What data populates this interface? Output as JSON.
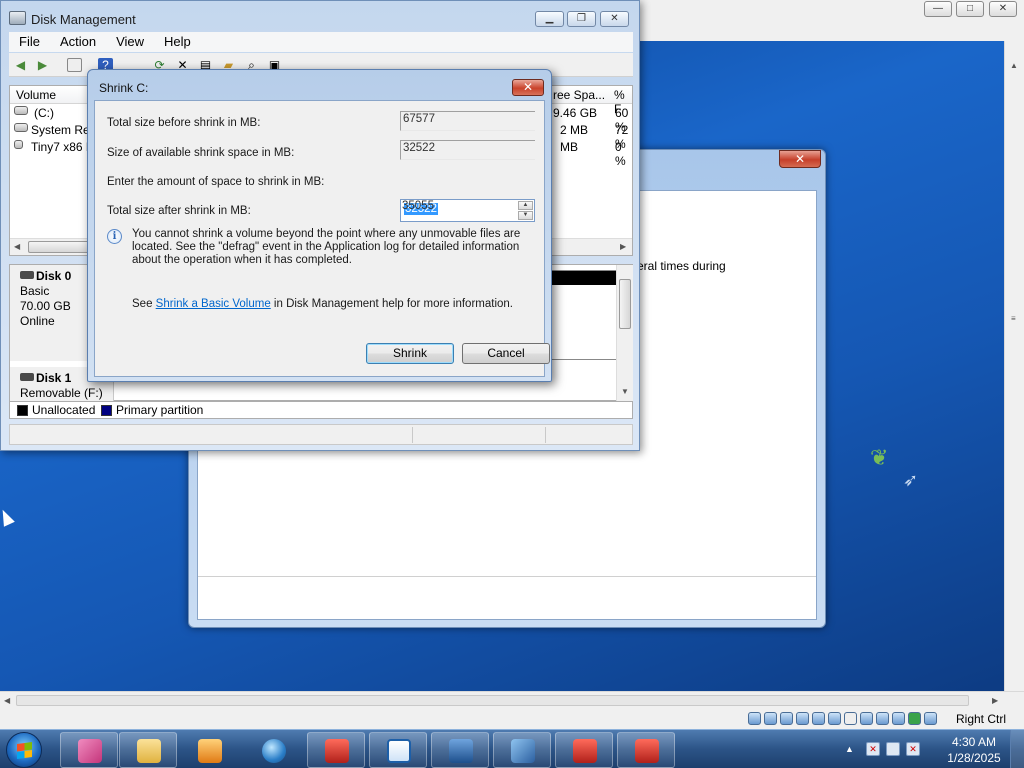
{
  "host": {
    "status_right": "Right Ctrl",
    "window_buttons": [
      "—",
      "□",
      "✕"
    ]
  },
  "background_window": {
    "partial_text": "eral times during"
  },
  "disk_management": {
    "title": "Disk Management",
    "menu": [
      "File",
      "Action",
      "View",
      "Help"
    ],
    "columns": [
      "Volume",
      "ree Spa...",
      "% F"
    ],
    "volumes": [
      {
        "name": "(C:)",
        "free": "9.46 GB",
        "pct": "60 %"
      },
      {
        "name": "System Res",
        "free": "2 MB",
        "pct": "72 %"
      },
      {
        "name": "Tiny7 x86 R",
        "free": "MB",
        "pct": "0 %"
      }
    ],
    "disks": [
      {
        "name": "Disk 0",
        "type": "Basic",
        "size": "70.00 GB",
        "status": "Online"
      },
      {
        "name": "Disk 1",
        "type": "Removable (F:)"
      }
    ],
    "legend": [
      {
        "label": "Unallocated",
        "color": "#000000"
      },
      {
        "label": "Primary partition",
        "color": "#000080"
      }
    ]
  },
  "dialog": {
    "title": "Shrink C:",
    "fields": [
      {
        "label": "Total size before shrink in MB:",
        "value": "67577"
      },
      {
        "label": "Size of available shrink space in MB:",
        "value": "32522"
      },
      {
        "label": "Enter the amount of space to shrink in MB:",
        "value": "32522"
      },
      {
        "label": "Total size after shrink in MB:",
        "value": "35055"
      }
    ],
    "info": "You cannot shrink a volume beyond the point where any unmovable files are located. See the \"defrag\" event in the Application log for detailed information about the operation when it has completed.",
    "help_prefix": "See ",
    "help_link": "Shrink a Basic Volume",
    "help_suffix": " in Disk Management help for more information.",
    "buttons": {
      "shrink": "Shrink",
      "cancel": "Cancel"
    }
  },
  "taskbar": {
    "apps": [
      "ink-app",
      "file-explorer",
      "media-player",
      "globe-app",
      "toolbox-app",
      "transfer-app",
      "package-app",
      "tiny7-app",
      "toolbox-app-2",
      "toolbox-app-3"
    ],
    "time": "4:30 AM",
    "date": "1/28/2025"
  }
}
